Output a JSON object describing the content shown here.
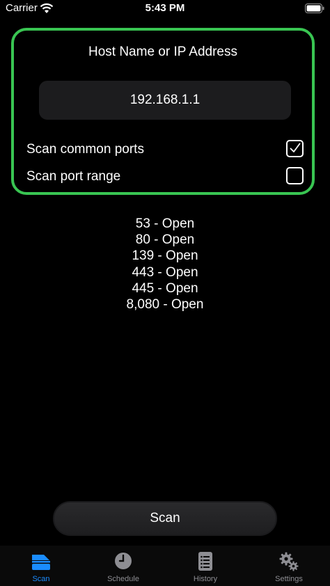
{
  "status_bar": {
    "carrier": "Carrier",
    "time": "5:43 PM",
    "icons": [
      "wifi-icon",
      "battery-icon"
    ]
  },
  "host": {
    "title": "Host Name or IP Address",
    "value": "192.168.1.1",
    "placeholder": ""
  },
  "options": [
    {
      "label": "Scan common ports",
      "checked": true
    },
    {
      "label": "Scan port range",
      "checked": false
    }
  ],
  "results": [
    "53 - Open",
    "80 - Open",
    "139 - Open",
    "443 - Open",
    "445 - Open",
    "8,080 - Open"
  ],
  "scan_button": {
    "label": "Scan"
  },
  "tabs": [
    {
      "label": "Scan",
      "icon": "scanner-icon",
      "active": true
    },
    {
      "label": "Schedule",
      "icon": "clock-icon",
      "active": false
    },
    {
      "label": "History",
      "icon": "list-icon",
      "active": false
    },
    {
      "label": "Settings",
      "icon": "gears-icon",
      "active": false
    }
  ],
  "colors": {
    "background": "#000000",
    "card_border": "#39c552",
    "input_bg": "#1c1c1e",
    "tab_active": "#1a8cff",
    "tab_inactive": "#8e8e93"
  }
}
